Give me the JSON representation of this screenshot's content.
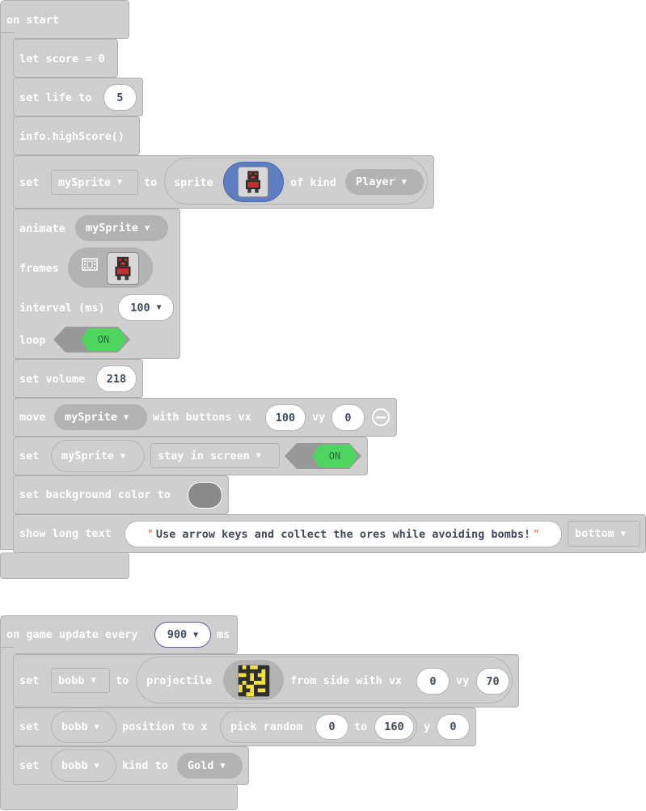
{
  "script1": {
    "hat": "on start",
    "let_score": "let score = 0",
    "set_life": {
      "label": "set life to",
      "value": "5"
    },
    "high_score": "info.highScore()",
    "set_sprite": {
      "set": "set",
      "var": "mySprite",
      "to": "to",
      "sprite": "sprite",
      "of_kind": "of kind",
      "kind": "Player"
    },
    "animate": {
      "label": "animate",
      "var": "mySprite",
      "frames": "frames",
      "interval": "interval (ms)",
      "interval_value": "100",
      "loop": "loop",
      "loop_state": "ON"
    },
    "set_volume": {
      "label": "set volume",
      "value": "218"
    },
    "move": {
      "label": "move",
      "var": "mySprite",
      "with_buttons": "with buttons vx",
      "vx": "100",
      "vy_label": "vy",
      "vy": "0"
    },
    "stay": {
      "set": "set",
      "var": "mySprite",
      "flag": "stay in screen",
      "state": "ON"
    },
    "background": {
      "label": "set background color to",
      "color": "#8a8a8a"
    },
    "long_text": {
      "label": "show long text",
      "text": "Use arrow keys and collect the ores while avoiding bombs!",
      "position": "bottom"
    }
  },
  "script2": {
    "hat": {
      "label": "on game update every",
      "value": "900",
      "unit": "ms"
    },
    "set_bobb": {
      "set": "set",
      "var": "bobb",
      "to": "to",
      "projectile": "projectile",
      "from_side": "from side with vx",
      "vx": "0",
      "vy_label": "vy",
      "vy": "70"
    },
    "position": {
      "set": "set",
      "var": "bobb",
      "position_to": "position to x",
      "pick_random": "pick random",
      "min": "0",
      "to": "to",
      "max": "160",
      "y_label": "y",
      "y": "0"
    },
    "kind": {
      "set": "set",
      "var": "bobb",
      "kind_to": "kind to",
      "kind": "Gold"
    }
  },
  "icons": {
    "dropdown": "triangle-down-icon",
    "film": "film-icon",
    "remove": "minus-circle-icon"
  }
}
